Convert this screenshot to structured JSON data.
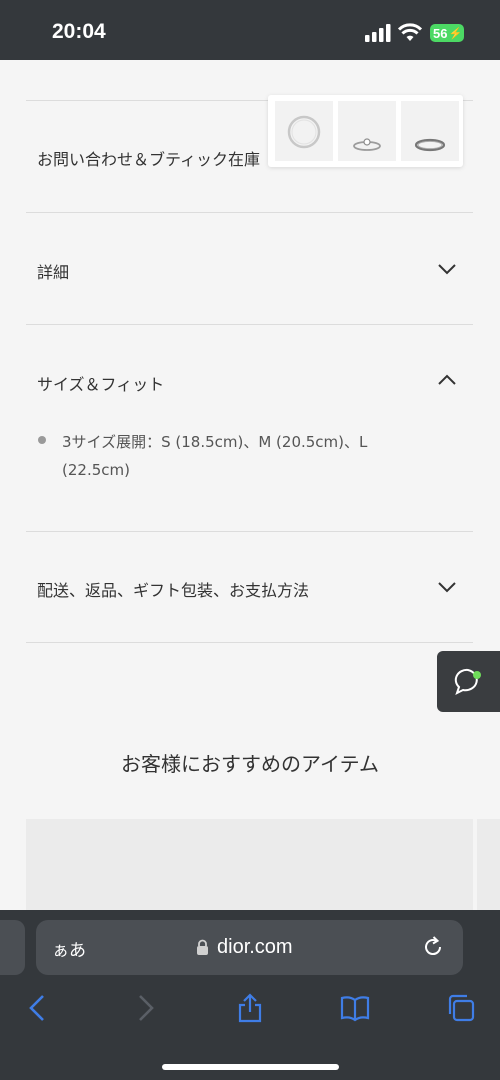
{
  "status_bar": {
    "time": "20:04",
    "battery": "56"
  },
  "product": {
    "contact_boutique": "お問い合わせ＆ブティック在庫",
    "details": "詳細",
    "size_fit": "サイズ＆フィット",
    "size_text": "3サイズ展開：S (18.5cm)、M (20.5cm)、L (22.5cm)",
    "shipping": "配送、返品、ギフト包装、お支払方法"
  },
  "thumbnails": [
    "bracelet-thumbnail",
    "ring-solitaire-thumbnail",
    "ring-band-thumbnail"
  ],
  "recommendations": {
    "title": "お客様におすすめのアイテム"
  },
  "browser": {
    "aa_label": "ぁあ",
    "url": "dior.com"
  },
  "colors": {
    "background": "#f5f5f5",
    "chrome": "#34383c",
    "toolbar_blue": "#3f7de6",
    "chat_dot": "#6fdc5a",
    "battery": "#4cd964"
  }
}
